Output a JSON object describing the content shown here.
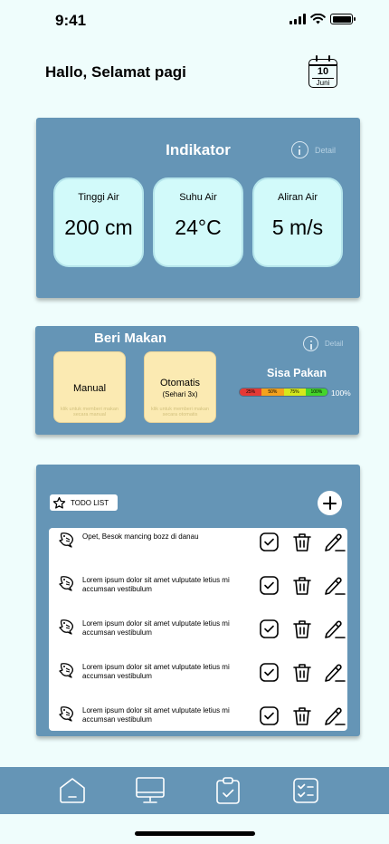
{
  "status_bar": {
    "time": "9:41"
  },
  "header": {
    "greeting": "Hallo, Selamat pagi",
    "calendar_day": "10",
    "calendar_month": "Juni"
  },
  "indikator": {
    "title": "Indikator",
    "detail_label": "Detail",
    "items": [
      {
        "label": "Tinggi Air",
        "value": "200 cm"
      },
      {
        "label": "Suhu Air",
        "value": "24°C"
      },
      {
        "label": "Aliran Air",
        "value": "5 m/s"
      }
    ]
  },
  "beri_makan": {
    "title": "Beri Makan",
    "detail_label": "Detail",
    "manual": {
      "label": "Manual",
      "hint": "klik untuk memberi makan secara manual"
    },
    "otomatis": {
      "label": "Otomatis",
      "sub": "(Sehari 3x)",
      "hint": "klik untuk memberi makan secara otomatis"
    },
    "sisa_pakan": {
      "title": "Sisa Pakan",
      "segments": [
        "25%",
        "50%",
        "75%",
        "100%"
      ],
      "segment_colors": [
        "#e53935",
        "#f4a21d",
        "#d6e81c",
        "#44d42a"
      ],
      "value_label": "100%"
    }
  },
  "todo": {
    "tag_label": "TODO LIST",
    "items": [
      {
        "text": "Opet, Besok mancing bozz di danau"
      },
      {
        "text": "Lorem ipsum dolor sit amet vulputate letius mi accumsan vestibulum"
      },
      {
        "text": "Lorem ipsum dolor sit amet vulputate letius mi accumsan vestibulum"
      },
      {
        "text": "Lorem ipsum dolor sit amet vulputate letius mi accumsan vestibulum"
      },
      {
        "text": "Lorem ipsum dolor sit amet vulputate letius mi accumsan vestibulum"
      }
    ]
  },
  "nav": {
    "items": [
      "home-icon",
      "monitor-icon",
      "clipboard-check-icon",
      "checklist-icon"
    ]
  },
  "colors": {
    "background": "#effdfc",
    "card": "#6595b6",
    "indicator_bg": "#d2fafa",
    "feed_bg": "#fbeab2"
  }
}
